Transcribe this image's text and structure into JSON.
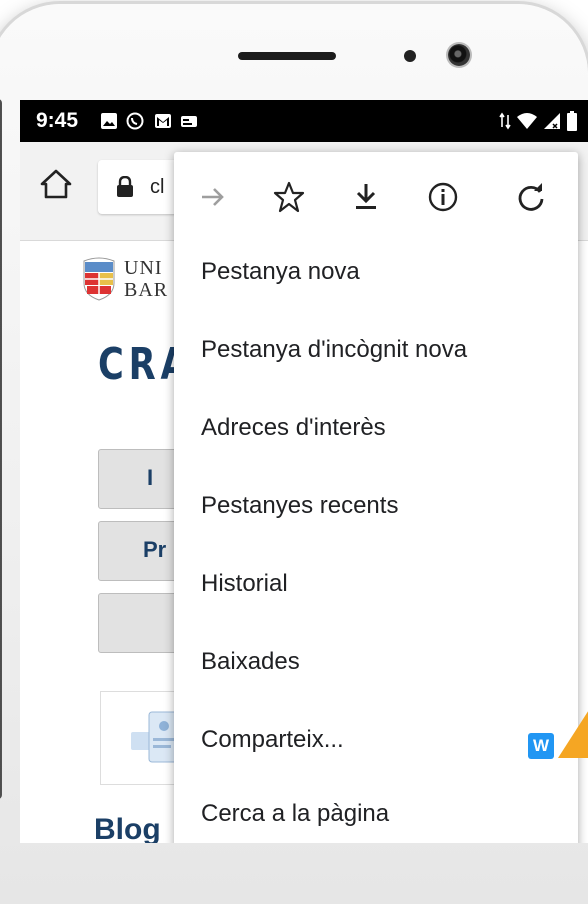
{
  "statusbar": {
    "time": "9:45"
  },
  "toolbar": {
    "url_text": "cl"
  },
  "page": {
    "logo_line1": "UNI",
    "logo_line2": "BAR",
    "heading": "CRA",
    "buttons": [
      "I",
      "Pr",
      ""
    ],
    "blogs_text": "Blog"
  },
  "menu": {
    "icons": [
      "forward-arrow-icon",
      "star-icon",
      "download-icon",
      "info-icon",
      "refresh-icon"
    ],
    "items": [
      {
        "label": "Pestanya nova"
      },
      {
        "label": "Pestanya d'incògnit nova"
      },
      {
        "label": "Adreces d'interès"
      },
      {
        "label": "Pestanyes recents"
      },
      {
        "label": "Historial"
      },
      {
        "label": "Baixades"
      },
      {
        "label": "Comparteix..."
      },
      {
        "label": "Cerca a la pàgina"
      }
    ],
    "share_badge": "W"
  },
  "colors": {
    "accent": "#1b3f66",
    "arrow": "#f5a623",
    "badge": "#2196f3"
  }
}
